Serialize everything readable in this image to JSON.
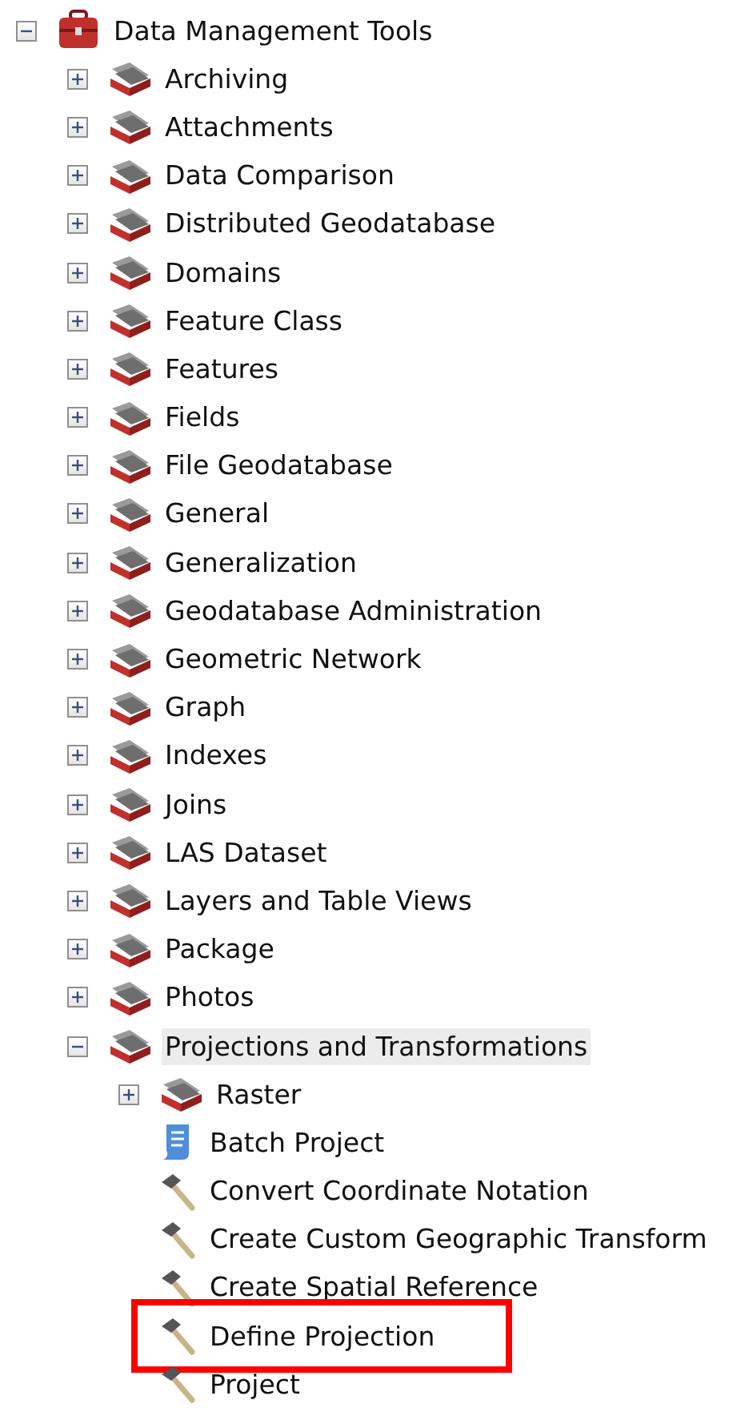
{
  "tree": {
    "label": "Data Management Tools",
    "kind": "toolbox",
    "expanded": true,
    "selected": false,
    "children": [
      {
        "label": "Archiving",
        "kind": "toolset",
        "expanded": false,
        "selected": false
      },
      {
        "label": "Attachments",
        "kind": "toolset",
        "expanded": false,
        "selected": false
      },
      {
        "label": "Data Comparison",
        "kind": "toolset",
        "expanded": false,
        "selected": false
      },
      {
        "label": "Distributed Geodatabase",
        "kind": "toolset",
        "expanded": false,
        "selected": false
      },
      {
        "label": "Domains",
        "kind": "toolset",
        "expanded": false,
        "selected": false
      },
      {
        "label": "Feature Class",
        "kind": "toolset",
        "expanded": false,
        "selected": false
      },
      {
        "label": "Features",
        "kind": "toolset",
        "expanded": false,
        "selected": false
      },
      {
        "label": "Fields",
        "kind": "toolset",
        "expanded": false,
        "selected": false
      },
      {
        "label": "File Geodatabase",
        "kind": "toolset",
        "expanded": false,
        "selected": false
      },
      {
        "label": "General",
        "kind": "toolset",
        "expanded": false,
        "selected": false
      },
      {
        "label": "Generalization",
        "kind": "toolset",
        "expanded": false,
        "selected": false
      },
      {
        "label": "Geodatabase Administration",
        "kind": "toolset",
        "expanded": false,
        "selected": false
      },
      {
        "label": "Geometric Network",
        "kind": "toolset",
        "expanded": false,
        "selected": false
      },
      {
        "label": "Graph",
        "kind": "toolset",
        "expanded": false,
        "selected": false
      },
      {
        "label": "Indexes",
        "kind": "toolset",
        "expanded": false,
        "selected": false
      },
      {
        "label": "Joins",
        "kind": "toolset",
        "expanded": false,
        "selected": false
      },
      {
        "label": "LAS Dataset",
        "kind": "toolset",
        "expanded": false,
        "selected": false
      },
      {
        "label": "Layers and Table Views",
        "kind": "toolset",
        "expanded": false,
        "selected": false
      },
      {
        "label": "Package",
        "kind": "toolset",
        "expanded": false,
        "selected": false
      },
      {
        "label": "Photos",
        "kind": "toolset",
        "expanded": false,
        "selected": false
      },
      {
        "label": "Projections and Transformations",
        "kind": "toolset",
        "expanded": true,
        "selected": true,
        "children": [
          {
            "label": "Raster",
            "kind": "toolset",
            "expanded": false,
            "selected": false
          },
          {
            "label": "Batch Project",
            "kind": "model",
            "selected": false,
            "highlighted": false
          },
          {
            "label": "Convert Coordinate Notation",
            "kind": "tool",
            "selected": false,
            "highlighted": false
          },
          {
            "label": "Create Custom Geographic Transform",
            "kind": "tool",
            "selected": false,
            "highlighted": false
          },
          {
            "label": "Create Spatial Reference",
            "kind": "tool",
            "selected": false,
            "highlighted": false
          },
          {
            "label": "Define Projection",
            "kind": "tool",
            "selected": false,
            "highlighted": true
          },
          {
            "label": "Project",
            "kind": "tool",
            "selected": false,
            "highlighted": false
          }
        ]
      }
    ]
  }
}
